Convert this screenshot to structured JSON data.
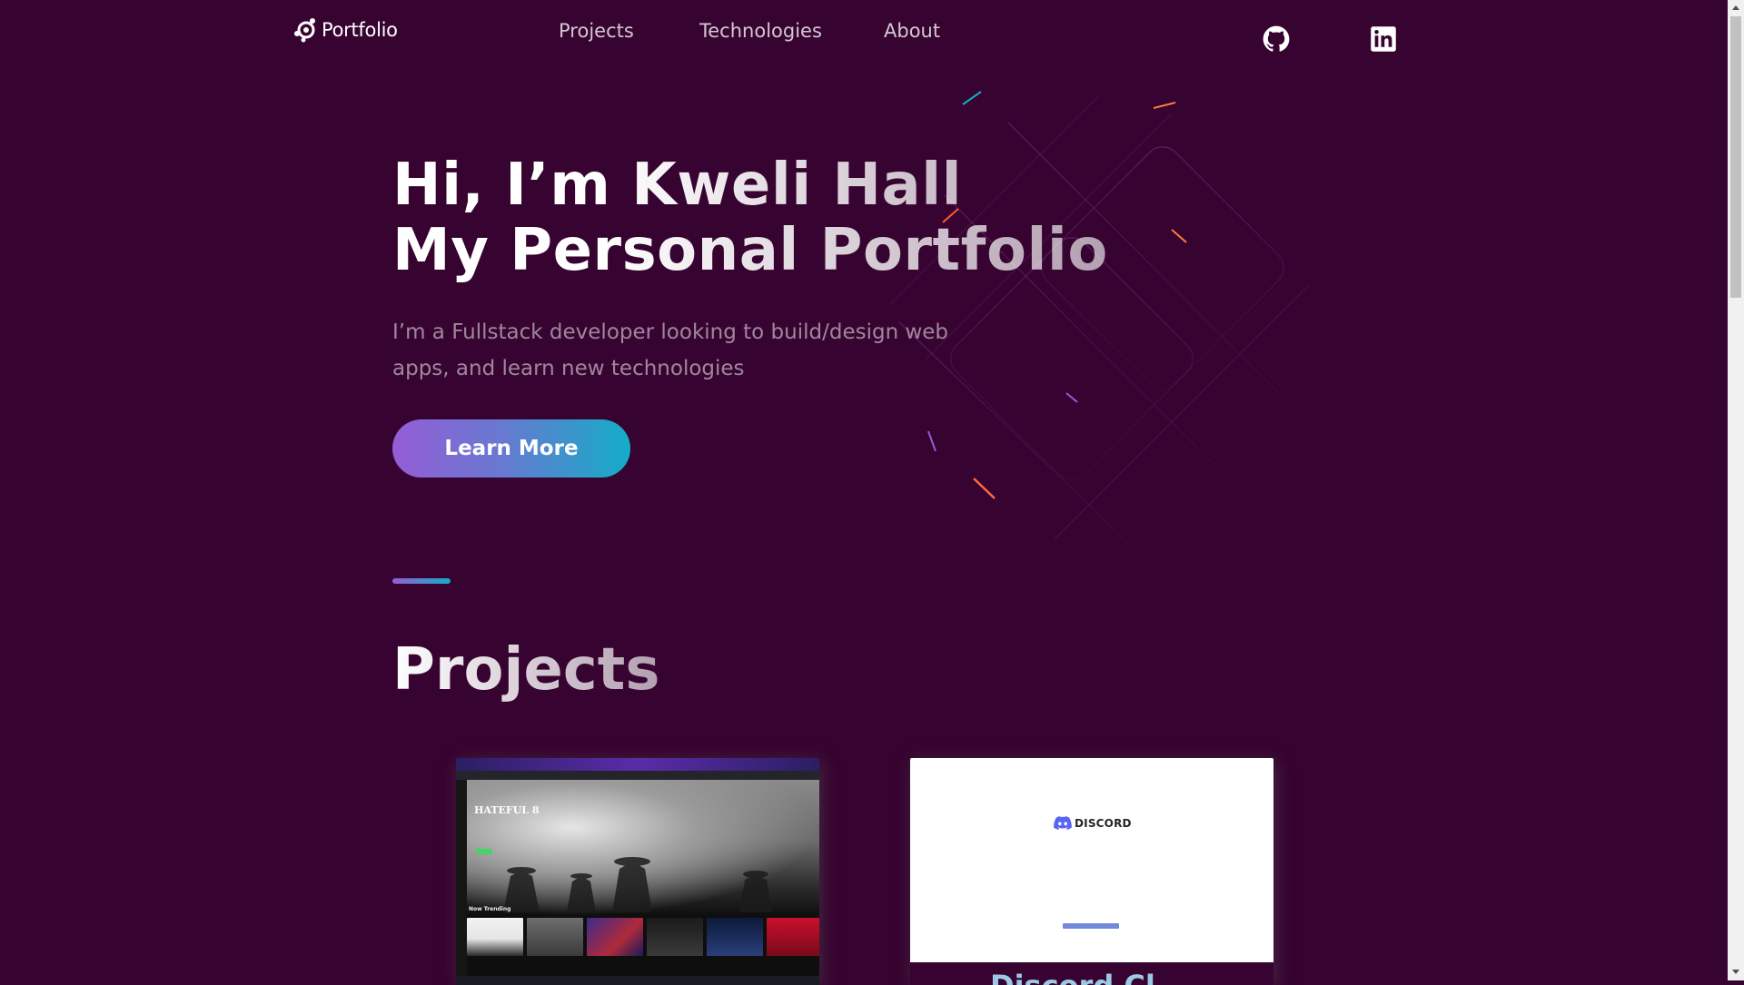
{
  "header": {
    "logo_text": "Portfolio",
    "nav": [
      {
        "label": "Projects"
      },
      {
        "label": "Technologies"
      },
      {
        "label": "About"
      }
    ],
    "social": [
      {
        "name": "github-icon"
      },
      {
        "name": "linkedin-icon"
      }
    ]
  },
  "hero": {
    "title_line1": "Hi, I’m Kweli Hall",
    "title_line2": "My Personal Portfolio",
    "subtitle": "I’m a Fullstack developer looking to build/design web apps, and learn new technologies",
    "button_label": "Learn More"
  },
  "projects": {
    "title": "Projects",
    "cards": [
      {
        "thumb_logo": "HATEFUL 8",
        "thumb_trending": "Now Trending"
      },
      {
        "thumb_logo": "DISCORD",
        "title": "Discord Cl"
      }
    ]
  },
  "colors": {
    "background": "#370330",
    "accent_start": "#945dd6",
    "accent_end": "#13adc7",
    "subtitle": "rgba(255,255,255,0.52)"
  }
}
